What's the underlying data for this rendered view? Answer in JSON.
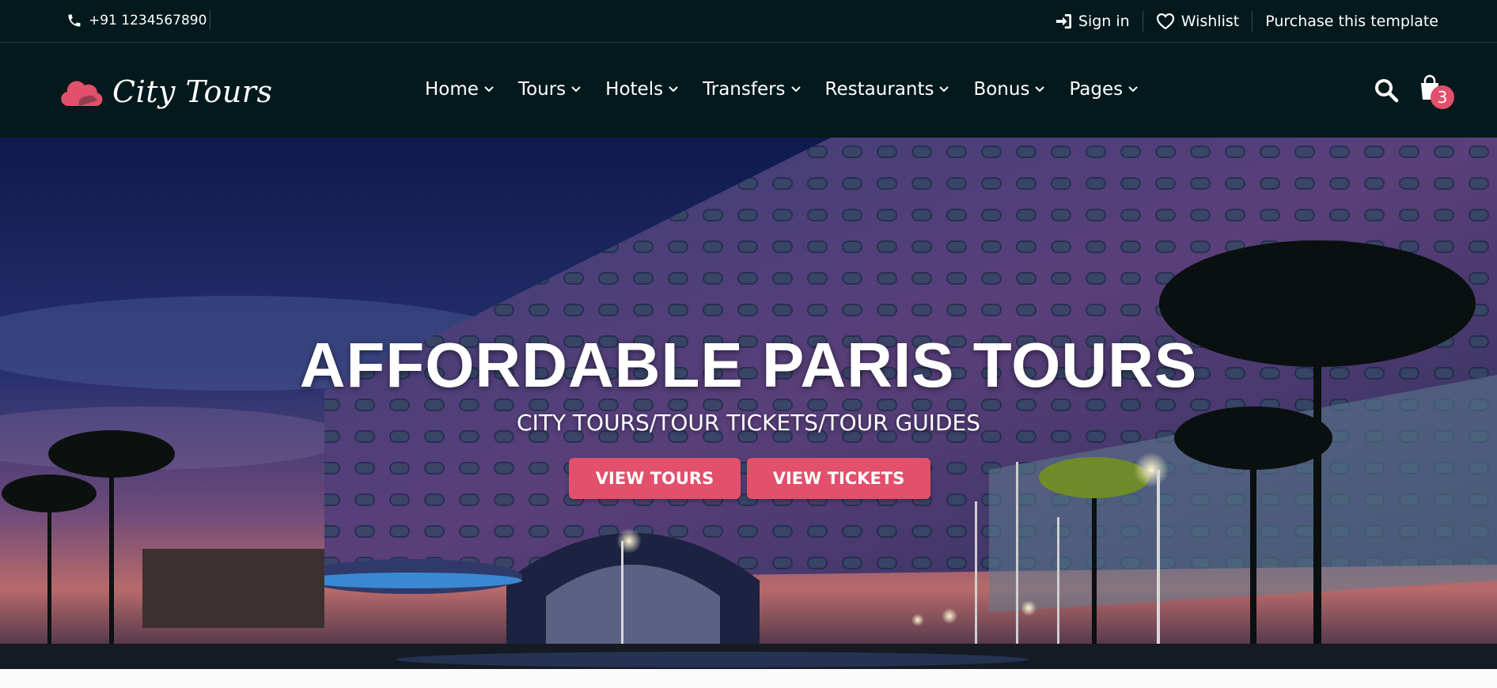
{
  "topbar": {
    "phone": "+91 1234567890",
    "sign_in": "Sign in",
    "wishlist": "Wishlist",
    "purchase": "Purchase this template"
  },
  "header": {
    "logo_text": "City Tours",
    "nav": [
      {
        "label": "Home"
      },
      {
        "label": "Tours"
      },
      {
        "label": "Hotels"
      },
      {
        "label": "Transfers"
      },
      {
        "label": "Restaurants"
      },
      {
        "label": "Bonus"
      },
      {
        "label": "Pages"
      }
    ],
    "cart_count": "3"
  },
  "hero": {
    "title": "AFFORDABLE PARIS TOURS",
    "subtitle": "CITY TOURS/TOUR TICKETS/TOUR GUIDES",
    "view_tours": "VIEW TOURS",
    "view_tickets": "VIEW TICKETS"
  },
  "colors": {
    "dark_bg": "#04191c",
    "accent": "#e2506b"
  },
  "icons": [
    "phone-icon",
    "sign-in-icon",
    "heart-icon",
    "cloud-logo-icon",
    "chevron-down-icon",
    "search-icon",
    "shopping-bag-icon"
  ]
}
